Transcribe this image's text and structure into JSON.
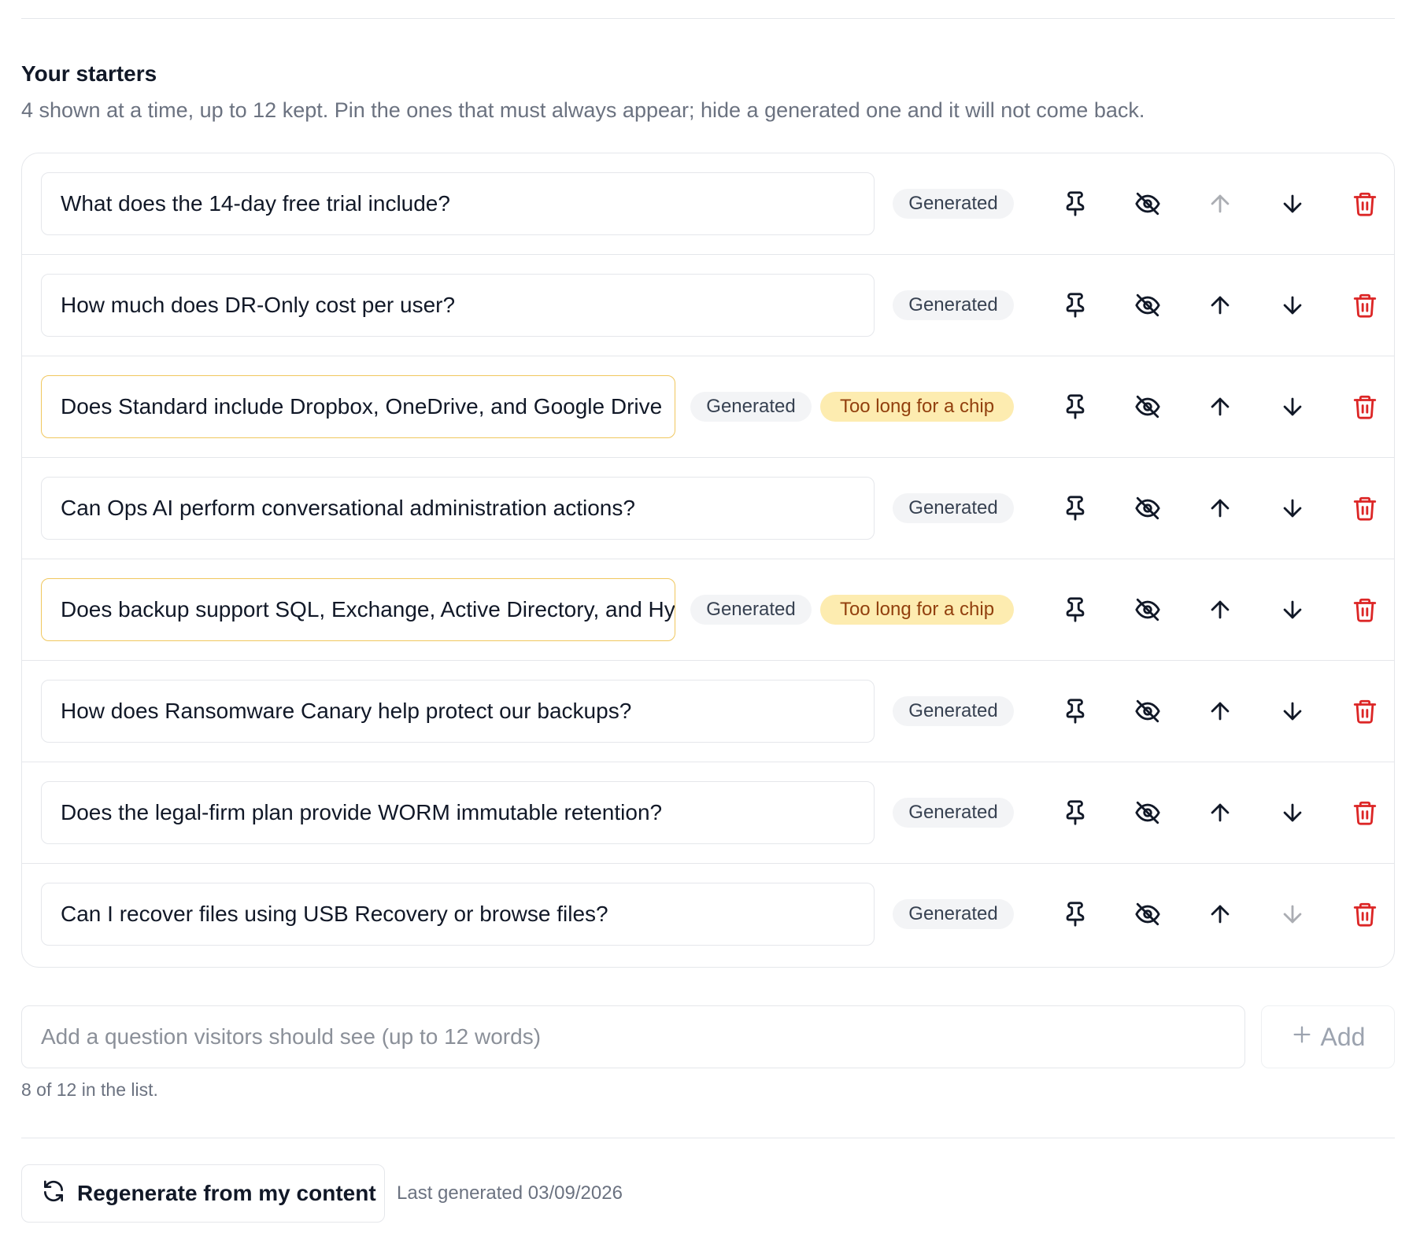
{
  "section": {
    "title": "Your starters",
    "description": "4 shown at a time, up to 12 kept. Pin the ones that must always appear; hide a generated one and it will not come back."
  },
  "starters": [
    {
      "text": "What does the 14-day free trial include?",
      "badges": [
        "Generated"
      ],
      "warning": false,
      "up_disabled": true,
      "down_disabled": false
    },
    {
      "text": "How much does DR-Only cost per user?",
      "badges": [
        "Generated"
      ],
      "warning": false,
      "up_disabled": false,
      "down_disabled": false
    },
    {
      "text": "Does Standard include Dropbox, OneDrive, and Google Drive",
      "badges": [
        "Generated",
        "Too long for a chip"
      ],
      "warning": true,
      "up_disabled": false,
      "down_disabled": false
    },
    {
      "text": "Can Ops AI perform conversational administration actions?",
      "badges": [
        "Generated"
      ],
      "warning": false,
      "up_disabled": false,
      "down_disabled": false
    },
    {
      "text": "Does backup support SQL, Exchange, Active Directory, and Hy",
      "badges": [
        "Generated",
        "Too long for a chip"
      ],
      "warning": true,
      "up_disabled": false,
      "down_disabled": false
    },
    {
      "text": "How does Ransomware Canary help protect our backups?",
      "badges": [
        "Generated"
      ],
      "warning": false,
      "up_disabled": false,
      "down_disabled": false
    },
    {
      "text": "Does the legal-firm plan provide WORM immutable retention?",
      "badges": [
        "Generated"
      ],
      "warning": false,
      "up_disabled": false,
      "down_disabled": false
    },
    {
      "text": "Can I recover files using USB Recovery or browse files?",
      "badges": [
        "Generated"
      ],
      "warning": false,
      "up_disabled": false,
      "down_disabled": true
    }
  ],
  "row_icons": {
    "pin": "pin-icon",
    "hide": "eye-off-icon",
    "up": "arrow-up-icon",
    "down": "arrow-down-icon",
    "delete": "trash-icon"
  },
  "add": {
    "placeholder": "Add a question visitors should see (up to 12 words)",
    "value": "",
    "button_label": "Add",
    "count_note": "8 of 12 in the list."
  },
  "regenerate": {
    "button_label": "Regenerate from my content",
    "last_generated": "Last generated 03/09/2026"
  },
  "colors": {
    "warning_border": "#f0c75e",
    "warning_badge_bg": "#fdecb0",
    "warning_badge_text": "#92400e",
    "delete_icon": "#dc2626",
    "badge_bg": "#f3f4f6"
  }
}
